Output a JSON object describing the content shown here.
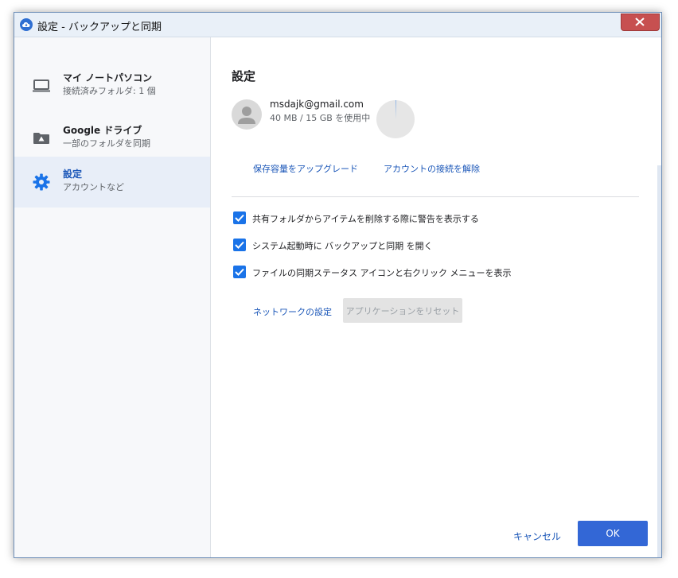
{
  "window": {
    "title": "設定 - バックアップと同期",
    "icon": "cloud-icon",
    "close_icon": "close-icon",
    "close_color": "#c75050"
  },
  "sidebar": {
    "items": [
      {
        "title": "マイ ノートパソコン",
        "subtitle": "接続済みフォルダ: 1 個",
        "icon": "laptop-icon",
        "active": false
      },
      {
        "title": "Google ドライブ",
        "subtitle": "一部のフォルダを同期",
        "icon": "drive-folder-icon",
        "active": false
      },
      {
        "title": "設定",
        "subtitle": "アカウントなど",
        "icon": "gear-icon",
        "active": true
      }
    ]
  },
  "settings": {
    "heading": "設定",
    "account": {
      "email": "msdajk@gmail.com",
      "usage": "40 MB / 15 GB を使用中",
      "storage_used_fraction": 0.0027
    },
    "links": {
      "upgrade": "保存容量をアップグレード",
      "disconnect": "アカウントの接続を解除"
    },
    "checkboxes": [
      {
        "label": "共有フォルダからアイテムを削除する際に警告を表示する",
        "checked": true
      },
      {
        "label": "システム起動時に バックアップと同期 を開く",
        "checked": true
      },
      {
        "label": "ファイルの同期ステータス アイコンと右クリック メニューを表示",
        "checked": true
      }
    ],
    "network_link": "ネットワークの設定",
    "reset_button": "アプリケーションをリセット"
  },
  "footer": {
    "cancel": "キャンセル",
    "ok": "OK"
  },
  "colors": {
    "accent": "#3367d6",
    "link": "#1a56b8",
    "checkbox": "#1a73e8",
    "active_nav_bg": "#e8eef8"
  }
}
